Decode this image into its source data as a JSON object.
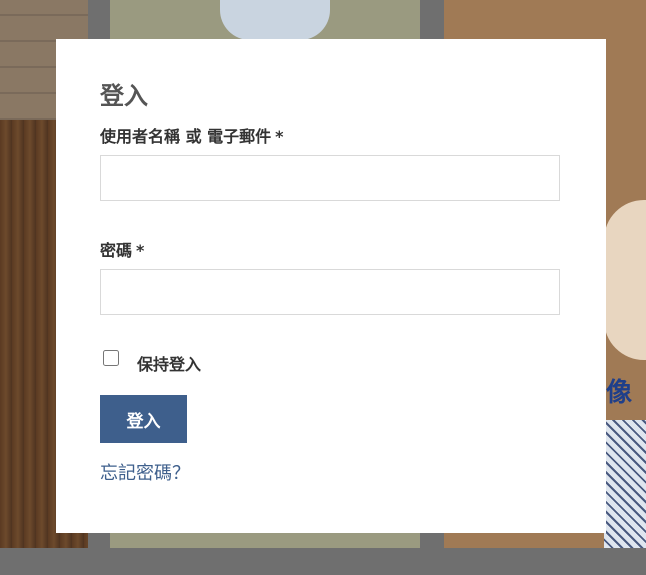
{
  "login": {
    "title": "登入",
    "username_label": "使用者名稱 或 電子郵件",
    "username_required": "*",
    "username_value": "",
    "password_label": "密碼",
    "password_required": "*",
    "password_value": "",
    "remember_label": "保持登入",
    "remember_checked": false,
    "submit_label": "登入",
    "forgot_link": "忘記密碼？"
  },
  "background": {
    "partial_text": "像"
  },
  "colors": {
    "accent": "#3e5f8c",
    "modal_bg": "#ffffff",
    "overlay": "#6f6f6f"
  }
}
